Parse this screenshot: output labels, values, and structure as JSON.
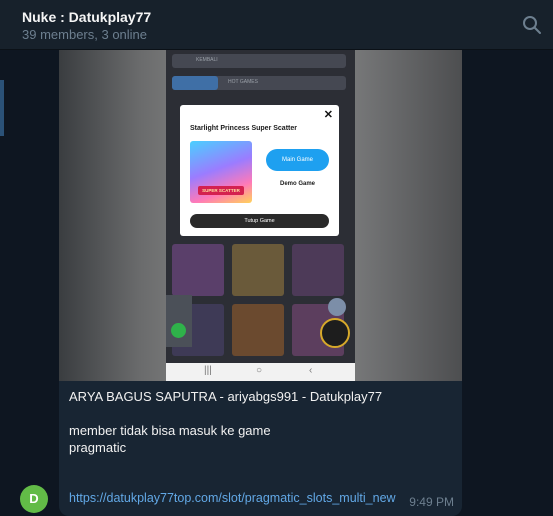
{
  "header": {
    "title": "Nuke : Datukplay77",
    "subtitle": "39 members, 3 online",
    "search_icon": "search-icon"
  },
  "message": {
    "avatar_initial": "D",
    "caption_line1": "ARYA BAGUS SAPUTRA - ariyabgs991 - Datukplay77",
    "caption_line2": "member tidak bisa masuk ke game",
    "caption_line3": "pragmatic",
    "link": "https://datukplay77top.com/slot/pragmatic_slots_multi_new",
    "time": "9:49 PM"
  },
  "screenshot": {
    "back_bar_label": "KEMBALI",
    "tab_label": "HOT GAMES",
    "modal_title": "Starlight Princess Super Scatter",
    "art_label": "SUPER SCATTER",
    "main_game_label": "Main Game",
    "demo_game_label": "Demo Game",
    "close_label": "Tutup Game",
    "nav_icons": [
      "recent-apps-icon",
      "home-icon",
      "back-icon"
    ]
  },
  "colors": {
    "background": "#0e1621",
    "header": "#17212b",
    "bubble": "#182533",
    "link": "#62a8e6",
    "avatar": "#62bb47",
    "main_button": "#1ea0f0"
  }
}
